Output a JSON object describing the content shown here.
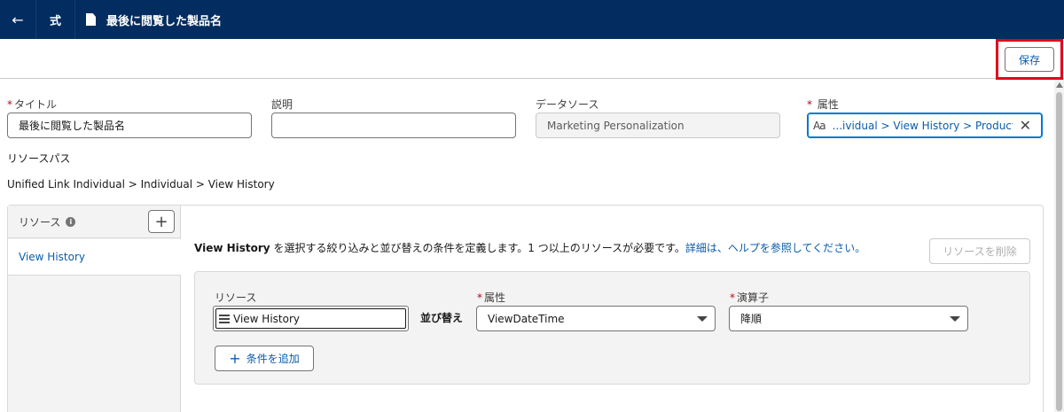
{
  "header": {
    "back_icon": "arrow-left-icon",
    "formula_label": "式",
    "doc_icon": "document-icon",
    "title": "最後に閲覧した製品名"
  },
  "toolbar": {
    "save_label": "保存",
    "highlight_color": "#e3001b"
  },
  "fields": {
    "title_label": "タイトル",
    "title_value": "最後に閲覧した製品名",
    "description_label": "説明",
    "description_value": "",
    "datasource_label": "データソース",
    "datasource_value": "Marketing Personalization",
    "attribute_label": "属性",
    "attribute_value": "...ividual > View History > ProductName",
    "attribute_type_icon": "Aa"
  },
  "resource_path": {
    "heading": "リソースパス",
    "path": "Unified Link Individual > Individual > View History"
  },
  "resources": {
    "header_label": "リソース",
    "items": [
      "View History"
    ]
  },
  "definition": {
    "resource_name": "View History",
    "description": " を選択する絞り込みと並び替えの条件を定義します。1 つ以上のリソースが必要です。",
    "help_link": "詳細は、ヘルプを参照してください。",
    "delete_label": "リソースを削除"
  },
  "condition": {
    "resource_label": "リソース",
    "resource_value": "View History",
    "sort_label": "並び替え",
    "attribute_label": "属性",
    "attribute_value": "ViewDateTime",
    "operator_label": "演算子",
    "operator_value": "降順",
    "add_label": "条件を追加"
  },
  "colors": {
    "header_bg": "#032d60",
    "link": "#0b5cab",
    "required": "#ba0517"
  }
}
